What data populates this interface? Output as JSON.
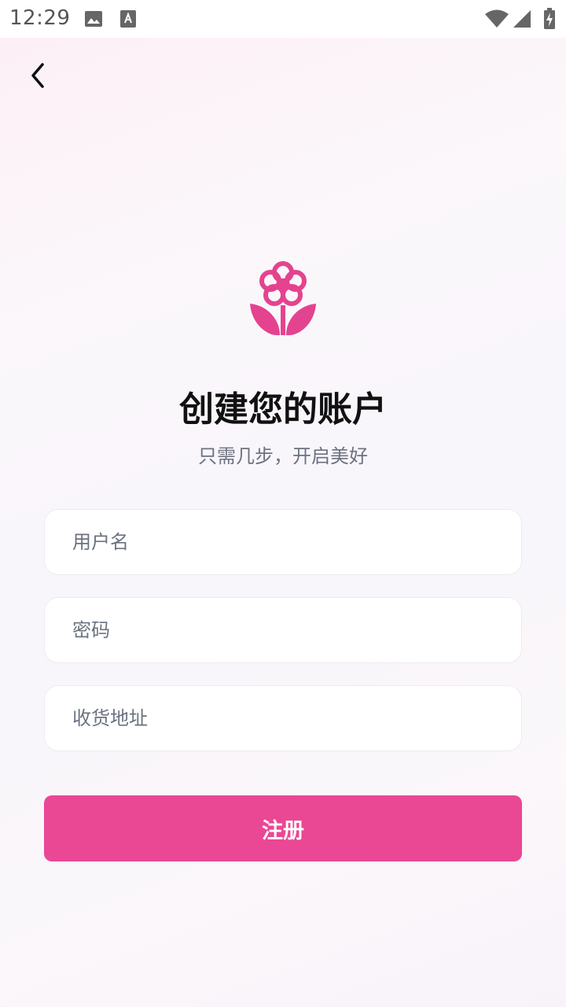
{
  "status_bar": {
    "time": "12:29",
    "icons": [
      "image-icon",
      "text-a-icon",
      "wifi-icon",
      "signal-icon",
      "battery-charging-icon"
    ]
  },
  "nav": {
    "back_icon": "chevron-left-icon"
  },
  "header": {
    "logo_icon": "flower-icon",
    "title": "创建您的账户",
    "subtitle": "只需几步，开启美好"
  },
  "form": {
    "username_placeholder": "用户名",
    "password_placeholder": "密码",
    "address_placeholder": "收货地址",
    "submit_label": "注册"
  },
  "colors": {
    "accent": "#ea4795",
    "logo": "#e4438f"
  }
}
